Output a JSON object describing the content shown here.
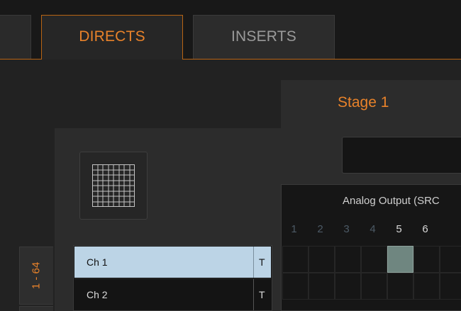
{
  "tabs": {
    "directs": "DIRECTS",
    "inserts": "INSERTS"
  },
  "stage": {
    "label": "Stage 1"
  },
  "range": {
    "label": "1 - 64"
  },
  "matrix": {
    "title": "Analog Output (SRC",
    "columns": [
      {
        "label": "1",
        "dim": true
      },
      {
        "label": "2",
        "dim": true
      },
      {
        "label": "3",
        "dim": true
      },
      {
        "label": "4",
        "dim": true
      },
      {
        "label": "5",
        "dim": false
      },
      {
        "label": "6",
        "dim": false
      }
    ],
    "active_cell": {
      "row": 0,
      "col": 4
    }
  },
  "channels": [
    {
      "name": "Ch 1",
      "tag": "T",
      "selected": true
    },
    {
      "name": "Ch 2",
      "tag": "T",
      "selected": false
    }
  ],
  "colors": {
    "accent": "#e8822a",
    "selected_row": "#bcd4e6",
    "active_cell": "#6f8680"
  }
}
